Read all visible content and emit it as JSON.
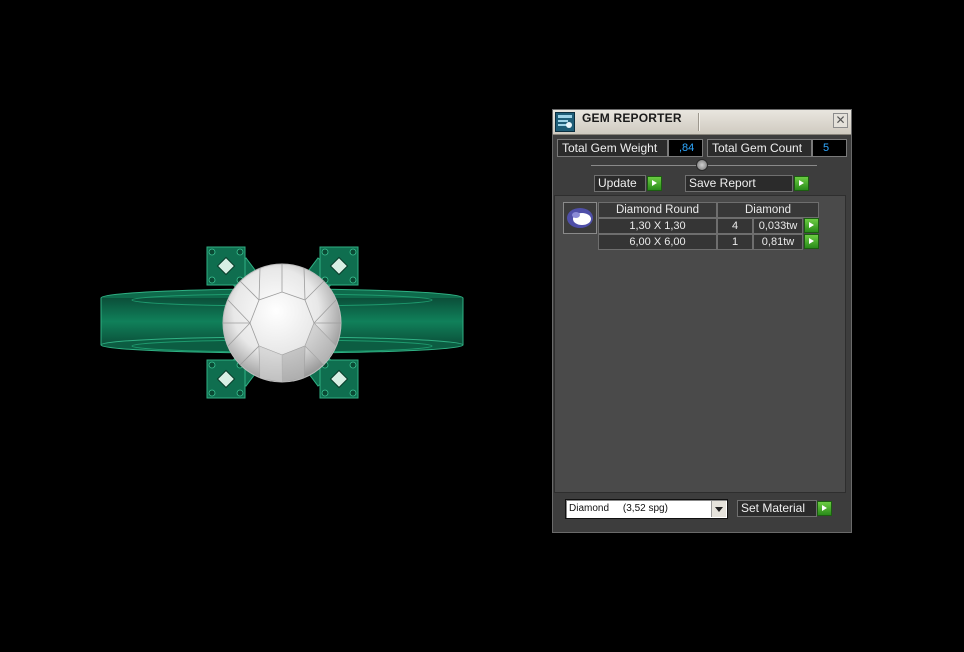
{
  "window": {
    "title": "GEM REPORTER",
    "close_glyph": "✕"
  },
  "summary": {
    "total_weight_label": "Total Gem Weight",
    "total_weight_value": ",84",
    "total_count_label": "Total Gem Count",
    "total_count_value": "5"
  },
  "actions": {
    "update_label": "Update",
    "save_report_label": "Save Report",
    "set_material_label": "Set Material"
  },
  "gem_table": {
    "shape_header": "Diamond Round",
    "material_header": "Diamond",
    "rows": [
      {
        "size": "1,30 X 1,30",
        "count": "4",
        "weight": "0,033tw"
      },
      {
        "size": "6,00 X 6,00",
        "count": "1",
        "weight": "0,81tw"
      }
    ]
  },
  "material": {
    "selected": "Diamond     (3,52 spg)"
  },
  "icons": {
    "app": "gem-reporter-icon",
    "close": "close-icon",
    "go": "play-arrow-icon",
    "gem": "gem-thumbnail-icon",
    "dropdown": "chevron-down-icon"
  },
  "colors": {
    "ring_metal": "#0f6e4f",
    "value_text": "#2ea8ff",
    "go_button": "#3fa82a",
    "panel_bg": "#3d3d3d"
  }
}
